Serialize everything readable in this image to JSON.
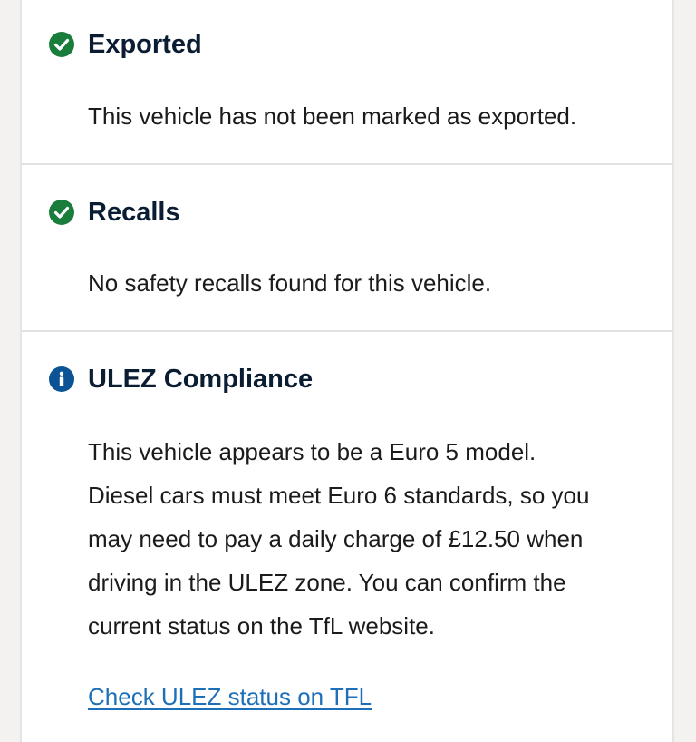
{
  "sections": [
    {
      "title": "Exported",
      "status_icon": "check-circle-icon",
      "text": "This vehicle has not been marked as exported."
    },
    {
      "title": "Recalls",
      "status_icon": "check-circle-icon",
      "text": "No safety recalls found for this vehicle."
    },
    {
      "title": "ULEZ Compliance",
      "status_icon": "info-circle-icon",
      "text_lines": [
        "This vehicle appears to be a Euro 5 model.",
        "Diesel cars must meet Euro 6 standards, so you",
        "may need to pay a daily charge of £12.50 when",
        "driving in the ULEZ zone. You can confirm the",
        "current status on the TfL website."
      ],
      "link_label": "Check ULEZ status on TFL"
    }
  ],
  "colors": {
    "success": "#1a7d3c",
    "info": "#0b5395",
    "link": "#1d70b8",
    "heading": "#0b1d33"
  }
}
